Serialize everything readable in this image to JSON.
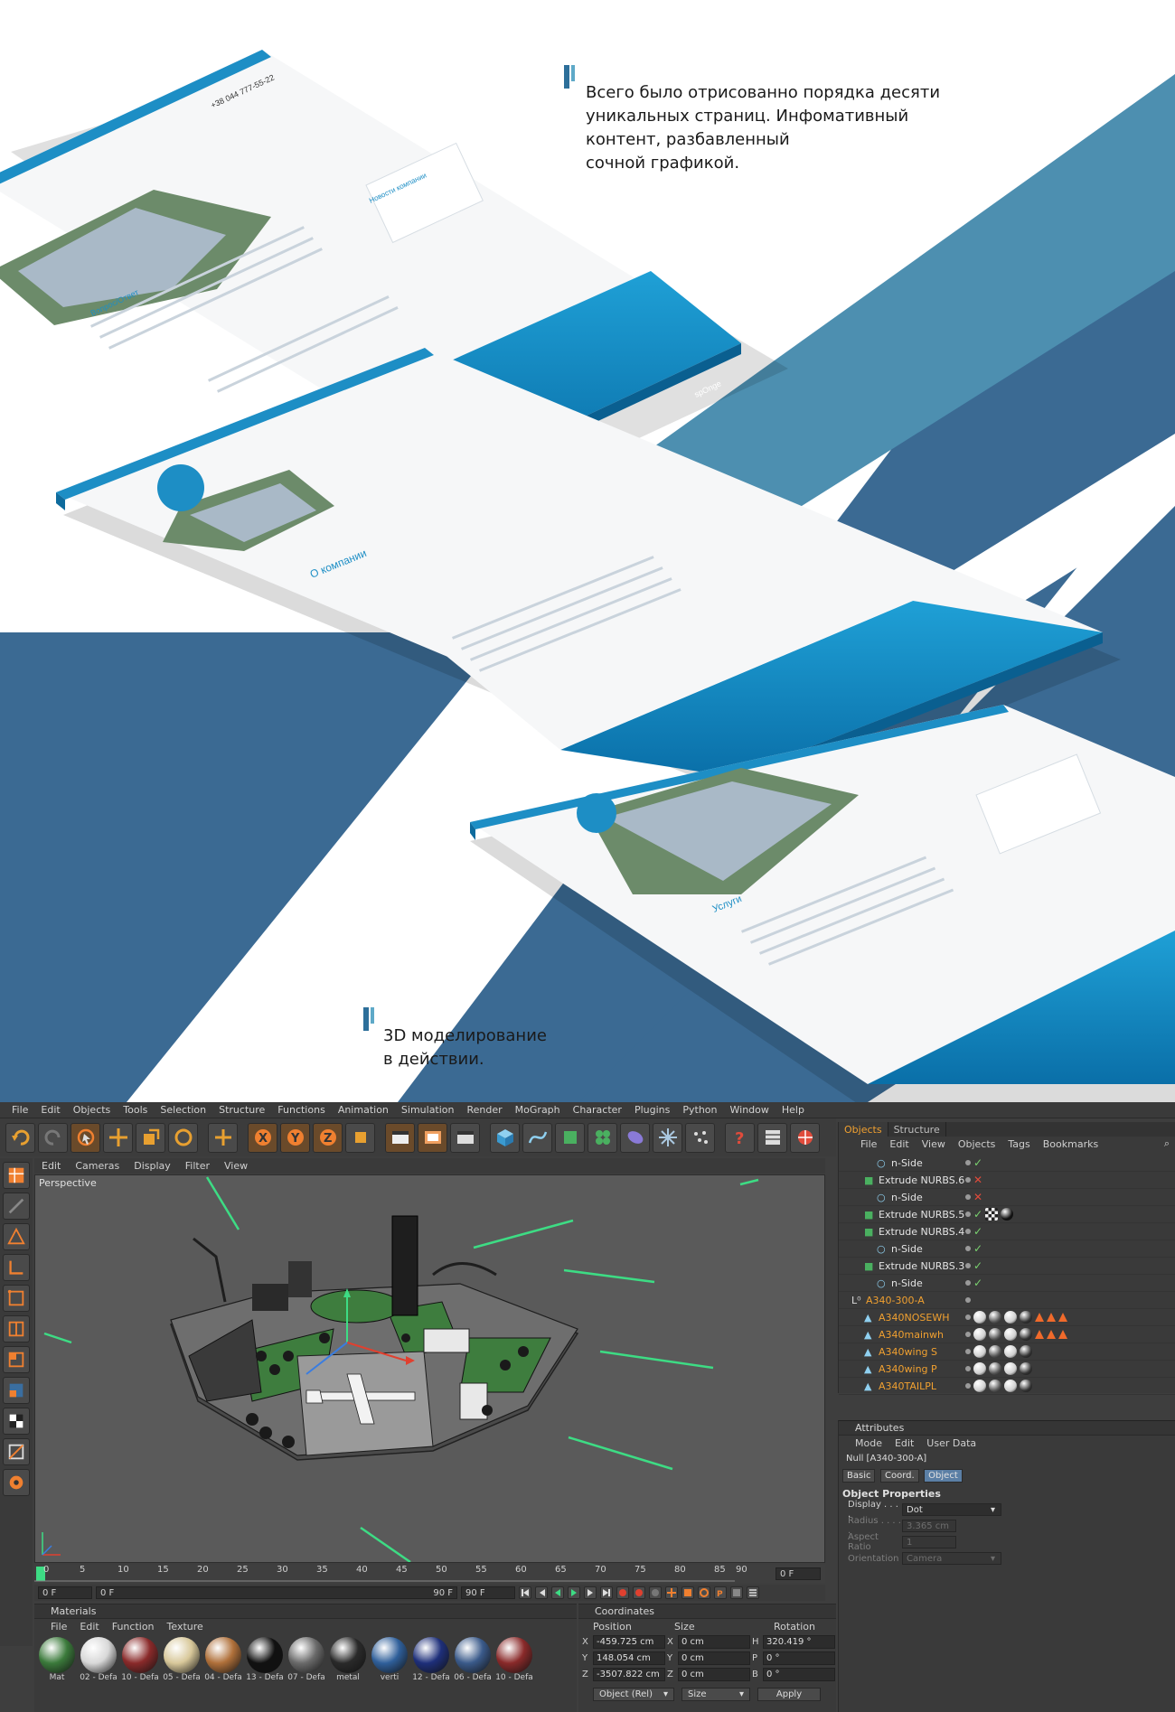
{
  "presentation": {
    "caption_top": {
      "lines": [
        "Всего было отрисованно порядка десяти",
        "уникальных страниц. Инфомативный",
        "контент, разбавленный",
        "сочной графикой."
      ]
    },
    "caption_bottom": {
      "lines": [
        "3D моделирование",
        "в действии."
      ]
    },
    "mockup_texts": {
      "phone": "+38 044 777-55-22",
      "faq_title": "Вопрос/Ответ",
      "about_title": "О компании",
      "services_title": "Услуги",
      "news_title": "Новости компании",
      "brand": "spOnge"
    },
    "colors": {
      "dark_blue": "#3b6a93",
      "mid_blue": "#4d8cb2",
      "accent": "#1d8ec5"
    }
  },
  "c4d": {
    "menu": [
      "File",
      "Edit",
      "Objects",
      "Tools",
      "Selection",
      "Structure",
      "Functions",
      "Animation",
      "Simulation",
      "Render",
      "MoGraph",
      "Character",
      "Plugins",
      "Python",
      "Window",
      "Help"
    ],
    "toolbar_icons": [
      "undo-icon",
      "redo-icon",
      "live-select-icon",
      "move-icon",
      "scale-icon",
      "rotate-icon",
      "add-icon",
      "x-axis-icon",
      "y-axis-icon",
      "z-axis-icon",
      "coordinate-system-icon",
      "render-view-icon",
      "render-picture-queue-icon",
      "render-settings-icon",
      "cube-icon",
      "spline-pen-icon",
      "nurbs-icon",
      "array-icon",
      "deformer-icon",
      "environment-icon",
      "scene-icon",
      "help-icon",
      "floor-icon",
      "camera-icon"
    ],
    "viewport": {
      "menu": [
        "Edit",
        "Cameras",
        "Display",
        "Filter",
        "View"
      ],
      "label": "Perspective"
    },
    "timeline": {
      "ticks": [
        "0",
        "5",
        "10",
        "15",
        "20",
        "25",
        "30",
        "35",
        "40",
        "45",
        "50",
        "55",
        "60",
        "65",
        "70",
        "75",
        "80",
        "85",
        "90"
      ],
      "current_frame_right": "0 F",
      "start_field": "0 F",
      "start_value": "0 F",
      "end_value": "90 F",
      "end_field": "90 F"
    },
    "materials": {
      "title": "Materials",
      "menu": [
        "File",
        "Edit",
        "Function",
        "Texture"
      ],
      "items": [
        {
          "name": "Mat",
          "color": "#3b7a3b"
        },
        {
          "name": "02 - Defa",
          "color": "#d8d8d8"
        },
        {
          "name": "10 - Defa",
          "color": "#8a2a2a"
        },
        {
          "name": "05 - Defa",
          "color": "#d8c89a"
        },
        {
          "name": "04 - Defa",
          "color": "#b0703a"
        },
        {
          "name": "13 - Defa",
          "color": "#111111"
        },
        {
          "name": "07 - Defa",
          "color": "#6a6a6a"
        },
        {
          "name": "metal",
          "color": "#2a2a2a"
        },
        {
          "name": "verti",
          "color": "#2f5f9a"
        },
        {
          "name": "12 - Defa",
          "color": "#1e2f7a"
        },
        {
          "name": "06 - Defa",
          "color": "#3a5a8a"
        },
        {
          "name": "10 - Defa",
          "color": "#8a2a2a"
        }
      ]
    },
    "coordinates": {
      "title": "Coordinates",
      "headers": [
        "Position",
        "Size",
        "Rotation"
      ],
      "rows": [
        {
          "axis": "X",
          "pos": "-459.725 cm",
          "size_axis": "X",
          "size": "0 cm",
          "rot_axis": "H",
          "rot": "320.419 °"
        },
        {
          "axis": "Y",
          "pos": "148.054 cm",
          "size_axis": "Y",
          "size": "0 cm",
          "rot_axis": "P",
          "rot": "0 °"
        },
        {
          "axis": "Z",
          "pos": "-3507.822 cm",
          "size_axis": "Z",
          "size": "0 cm",
          "rot_axis": "B",
          "rot": "0 °"
        }
      ],
      "mode": "Object (Rel)",
      "size_mode": "Size",
      "apply": "Apply"
    },
    "objects_panel": {
      "tabs": [
        "Objects",
        "Structure"
      ],
      "menu": [
        "File",
        "Edit",
        "View",
        "Objects",
        "Tags",
        "Bookmarks"
      ],
      "rows": [
        {
          "name": "n-Side",
          "indent": 2,
          "orange": false
        },
        {
          "name": "Extrude NURBS.6",
          "indent": 1,
          "orange": false
        },
        {
          "name": "n-Side",
          "indent": 2,
          "orange": false
        },
        {
          "name": "Extrude NURBS.5",
          "indent": 1,
          "orange": false
        },
        {
          "name": "Extrude NURBS.4",
          "indent": 1,
          "orange": false
        },
        {
          "name": "n-Side",
          "indent": 2,
          "orange": false
        },
        {
          "name": "Extrude NURBS.3",
          "indent": 1,
          "orange": false
        },
        {
          "name": "n-Side",
          "indent": 2,
          "orange": false
        },
        {
          "name": "A340-300-A",
          "indent": 0,
          "orange": true
        },
        {
          "name": "A340NOSEWH",
          "indent": 1,
          "orange": true
        },
        {
          "name": "A340mainwh",
          "indent": 1,
          "orange": true
        },
        {
          "name": "A340wing S",
          "indent": 1,
          "orange": true
        },
        {
          "name": "A340wing P",
          "indent": 1,
          "orange": true
        },
        {
          "name": "A340TAILPL",
          "indent": 1,
          "orange": true
        }
      ]
    },
    "attributes": {
      "title": "Attributes",
      "menu": [
        "Mode",
        "Edit",
        "User Data"
      ],
      "object_name": "Null [A340-300-A]",
      "tabs": [
        "Basic",
        "Coord.",
        "Object"
      ],
      "section": "Object Properties",
      "props": [
        {
          "label": "Display . . . .",
          "value": "Dot",
          "dim": false
        },
        {
          "label": "Radius . . . . .",
          "value": "3.365 cm",
          "dim": true
        },
        {
          "label": "Aspect Ratio",
          "value": "1",
          "dim": true
        },
        {
          "label": "Orientation",
          "value": "Camera",
          "dim": true
        }
      ]
    }
  }
}
